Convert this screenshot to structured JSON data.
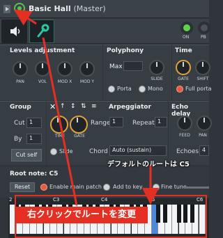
{
  "window": {
    "title": "Basic Hall",
    "subtitle": "(Master)"
  },
  "top": {
    "on_label": "ON",
    "pb_label": "PB"
  },
  "levels": {
    "title": "Levels adjustment",
    "knobs": [
      "PAN",
      "VOL",
      "MOD X",
      "MOD Y"
    ]
  },
  "polyphony": {
    "title": "Polyphony",
    "max_label": "Max",
    "slide_label": "SLIDE",
    "porta_label": "Porta",
    "mono_label": "Mono"
  },
  "time": {
    "title": "Time",
    "knobs": [
      "GATE",
      "SHIFT"
    ],
    "full_porta_label": "Full porta"
  },
  "group": {
    "title": "Group",
    "cut_label": "Cut",
    "cut_value": "1",
    "by_label": "By",
    "by_value": "1",
    "cut_self_label": "Cut self"
  },
  "arpeggiator": {
    "title": "Arpeggiator",
    "time_label": "TIME",
    "gate_label": "GATE",
    "range_label": "Range",
    "range_value": "1",
    "repeat_label": "Repeat",
    "repeat_value": "1",
    "slide_label": "Slide",
    "chord_label": "Chord",
    "chord_value": "Auto (sustain)"
  },
  "echo": {
    "title": "Echo delay",
    "feed_label": "FEED",
    "pan_label": "PAN",
    "echoes_label": "Echoes",
    "echoes_value": "4"
  },
  "root_note": {
    "label": "Root note: C5",
    "reset_label": "Reset",
    "enable_label": "Enable main patch",
    "add_key_label": "Add to key",
    "fine_tune_label": "Fine tune"
  },
  "keyboard": {
    "octaves": [
      "2",
      "C3",
      "C4",
      "C5",
      "C6"
    ]
  },
  "annotations": {
    "default_root": "デフォルトのルートは C5",
    "instruction": "右クリックでルートを変更"
  },
  "colors": {
    "accent_red": "#e52f23",
    "accent_green": "#5fbf4b",
    "accent_orange": "#e0a23a",
    "key_highlight": "#4d89d8"
  }
}
